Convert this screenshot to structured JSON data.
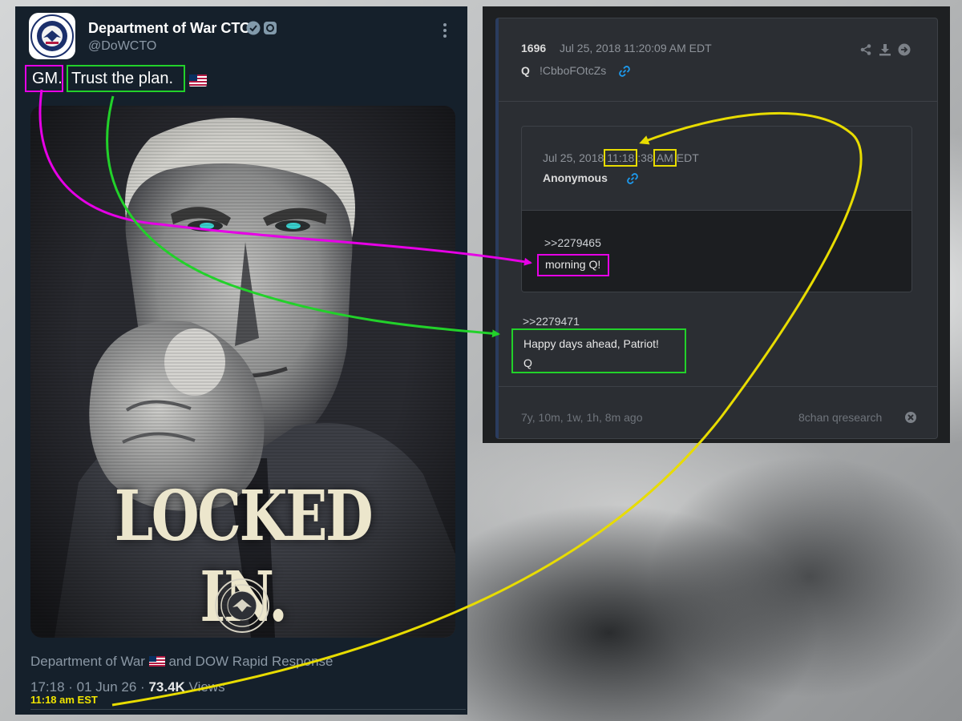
{
  "tweet": {
    "display_name": "Department of War CTO",
    "handle": "@DoWCTO",
    "text_gm": "GM.",
    "text_plan": "Trust the plan.",
    "poster_title": "LOCKED IN.",
    "media_credit_prefix": "Department of War",
    "media_credit_suffix": " and DOW Rapid Response",
    "time_date": "17:18 · 01 Jun 26 · ",
    "views_count": "73.4K",
    "views_label": " Views",
    "annotation_time": "11:18 am EST"
  },
  "qpost": {
    "number": "1696",
    "datetime": "Jul 25, 2018 11:20:09 AM EDT",
    "author": "Q",
    "tripcode": "!CbboFOtcZs",
    "quoted": {
      "date": "Jul 25, 2018 ",
      "time_hm": "11:18",
      "time_s": ":38 ",
      "ampm": "AM",
      "tz": " EDT",
      "author": "Anonymous",
      "ref": ">>2279465",
      "text": "morning Q!"
    },
    "reply_ref": ">>2279471",
    "reply_line1": "Happy days ahead, Patriot!",
    "reply_line2": "Q",
    "ago": "7y, 10m, 1w, 1h, 8m ago",
    "source": "8chan qresearch"
  },
  "colors": {
    "magenta_annotation": "#e600e6",
    "green_annotation": "#22d12a",
    "yellow_annotation": "#e8dc00",
    "tweet_bg": "#15202b",
    "q_bg": "#2b2e33",
    "link_blue": "#1d9bf0"
  },
  "icons": [
    "verified-icon",
    "government-affiliation-icon",
    "more-options-icon",
    "us-flag-emoji",
    "link-icon",
    "share-icon",
    "download-icon",
    "goto-icon",
    "close-icon"
  ]
}
